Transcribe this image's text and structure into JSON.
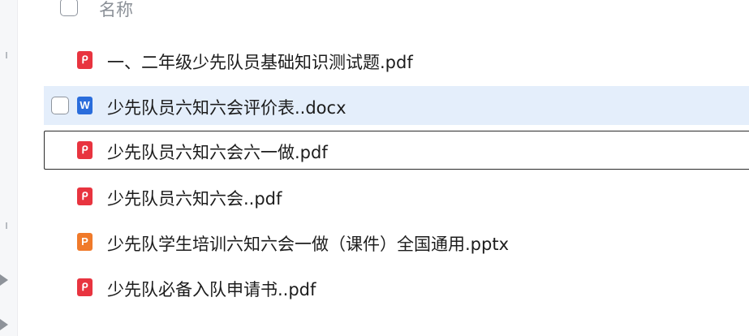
{
  "header": {
    "name_column_label": "名称"
  },
  "files": [
    {
      "name": "一、二年级少先队员基础知识测试题.pdf",
      "icon": "pdf-file-icon",
      "glyph": "ᑭ"
    },
    {
      "name": "少先队员六知六会评价表..docx",
      "icon": "word-file-icon",
      "glyph": "W"
    },
    {
      "name": "少先队员六知六会六一做.pdf",
      "icon": "pdf-file-icon",
      "glyph": "ᑭ"
    },
    {
      "name": "少先队员六知六会..pdf",
      "icon": "pdf-file-icon",
      "glyph": "ᑭ"
    },
    {
      "name": "少先队学生培训六知六会一做（课件）全国通用.pptx",
      "icon": "ppt-file-icon",
      "glyph": "P"
    },
    {
      "name": "少先队必备入队申请书..pdf",
      "icon": "pdf-file-icon",
      "glyph": "ᑭ"
    }
  ],
  "colors": {
    "selected_row_bg": "#e4eefb",
    "pdf_icon": "#e8343f",
    "word_icon": "#2a6ddc",
    "ppt_icon": "#f07a2a"
  }
}
